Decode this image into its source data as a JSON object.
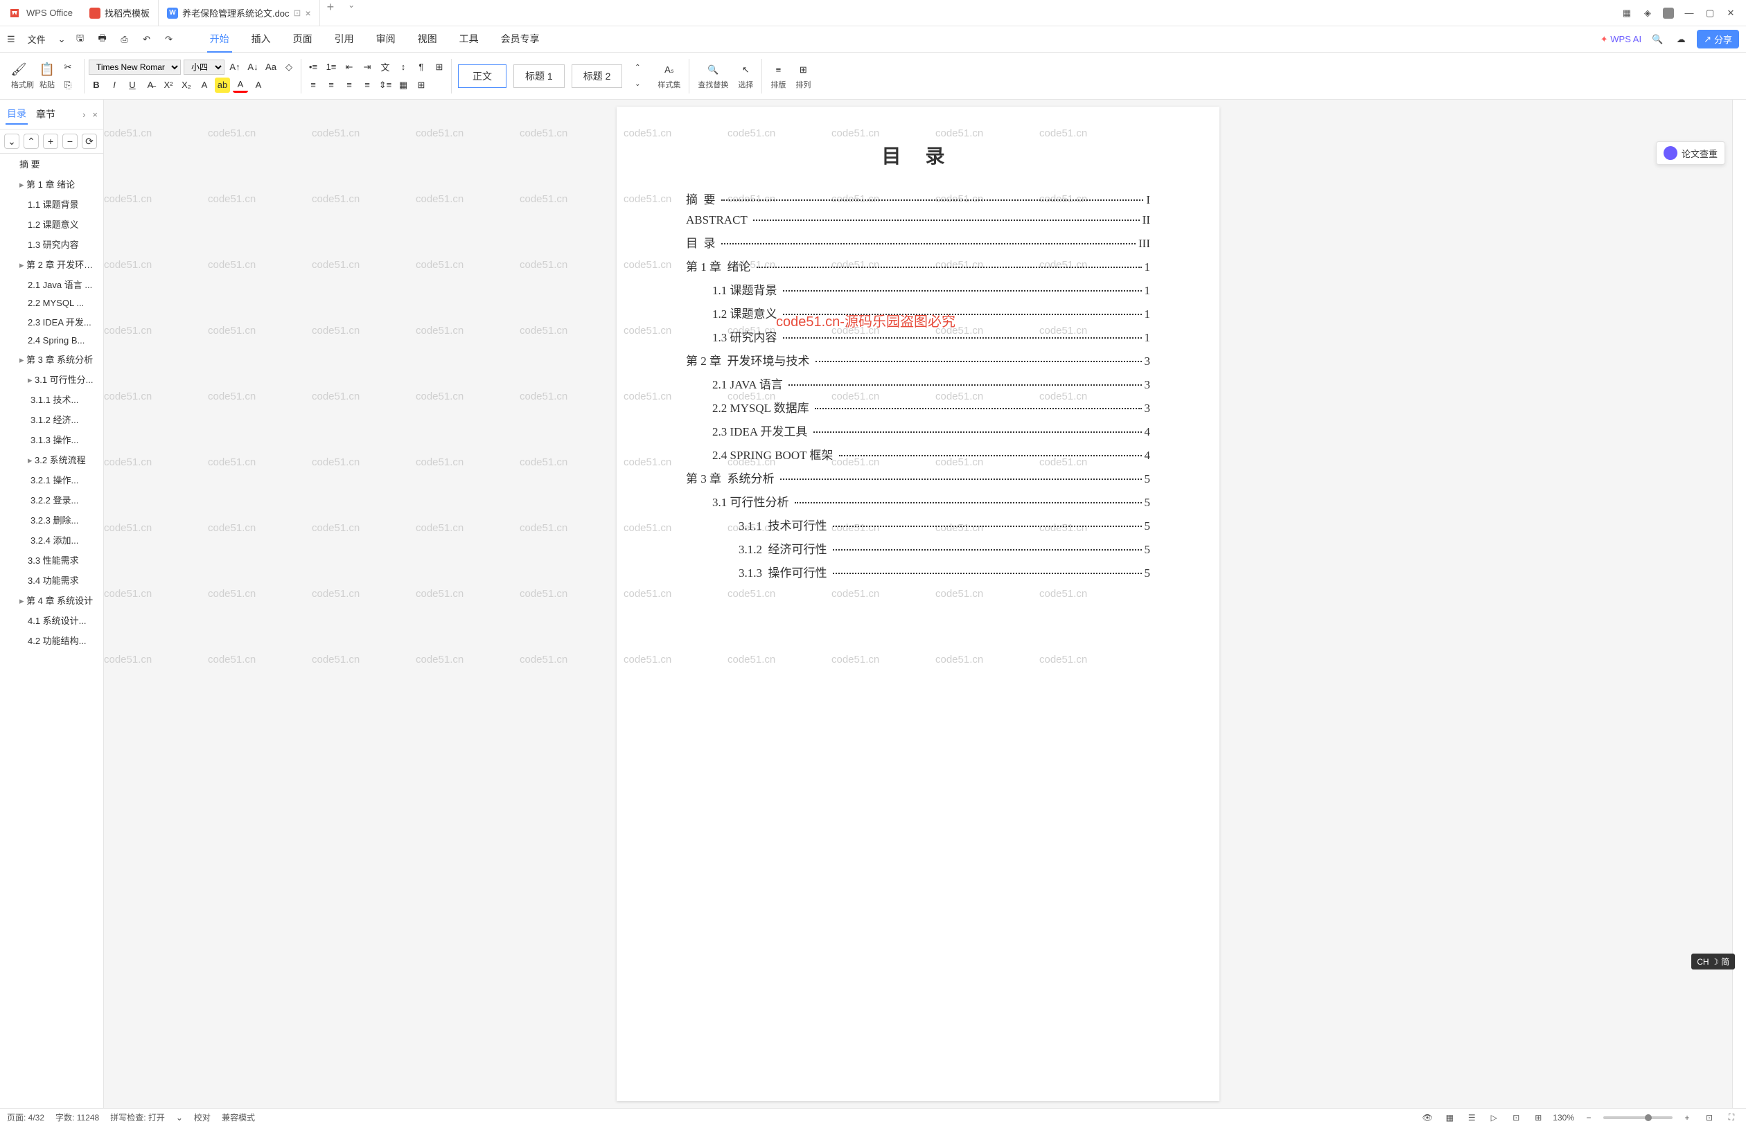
{
  "app": {
    "name": "WPS Office"
  },
  "tabs": [
    {
      "label": "找稻壳模板"
    },
    {
      "label": "养老保险管理系统论文.doc"
    }
  ],
  "menu": {
    "file": "文件",
    "items": [
      "开始",
      "插入",
      "页面",
      "引用",
      "审阅",
      "视图",
      "工具",
      "会员专享"
    ],
    "ai": "WPS AI",
    "share": "分享"
  },
  "toolbar": {
    "format_painter": "格式刷",
    "paste": "粘贴",
    "font": "Times New Romar",
    "size": "小四",
    "styles": [
      "正文",
      "标题 1",
      "标题 2"
    ],
    "styleset": "样式集",
    "findreplace": "查找替换",
    "select": "选择",
    "arrange_v": "排版",
    "arrange_h": "排列"
  },
  "sidebar": {
    "tabs": [
      "目录",
      "章节"
    ],
    "close": "×",
    "controls": [
      "⌄",
      "⌃",
      "+",
      "−",
      "⟳"
    ],
    "outline": [
      {
        "label": "摘 要",
        "level": 1
      },
      {
        "label": "第 1 章 绪论",
        "level": 1,
        "caret": true
      },
      {
        "label": "1.1 课题背景",
        "level": 2
      },
      {
        "label": "1.2 课题意义",
        "level": 2
      },
      {
        "label": "1.3 研究内容",
        "level": 2
      },
      {
        "label": "第 2 章 开发环境...",
        "level": 1,
        "caret": true
      },
      {
        "label": "2.1 Java 语言 ...",
        "level": 2
      },
      {
        "label": "2.2 MYSQL ...",
        "level": 2
      },
      {
        "label": "2.3 IDEA 开发...",
        "level": 2
      },
      {
        "label": "2.4 Spring B...",
        "level": 2
      },
      {
        "label": "第 3 章 系统分析",
        "level": 1,
        "caret": true
      },
      {
        "label": "3.1 可行性分...",
        "level": 2,
        "caret": true
      },
      {
        "label": "3.1.1 技术...",
        "level": 3
      },
      {
        "label": "3.1.2 经济...",
        "level": 3
      },
      {
        "label": "3.1.3 操作...",
        "level": 3
      },
      {
        "label": "3.2 系统流程",
        "level": 2,
        "caret": true
      },
      {
        "label": "3.2.1 操作...",
        "level": 3
      },
      {
        "label": "3.2.2 登录...",
        "level": 3
      },
      {
        "label": "3.2.3 删除...",
        "level": 3
      },
      {
        "label": "3.2.4 添加...",
        "level": 3
      },
      {
        "label": "3.3 性能需求",
        "level": 2
      },
      {
        "label": "3.4 功能需求",
        "level": 2
      },
      {
        "label": "第 4 章 系统设计",
        "level": 1,
        "caret": true
      },
      {
        "label": "4.1 系统设计...",
        "level": 2
      },
      {
        "label": "4.2 功能结构...",
        "level": 2
      }
    ]
  },
  "doc": {
    "title": "目 录",
    "toc": [
      {
        "text": "摘  要",
        "page": "I",
        "level": 1
      },
      {
        "text": "ABSTRACT",
        "page": "II",
        "level": 1
      },
      {
        "text": "目  录",
        "page": "III",
        "level": 1
      },
      {
        "text": "第 1 章  绪论",
        "page": "1",
        "level": 1
      },
      {
        "text": "1.1 课题背景",
        "page": "1",
        "level": 2
      },
      {
        "text": "1.2 课题意义",
        "page": "1",
        "level": 2
      },
      {
        "text": "1.3 研究内容",
        "page": "1",
        "level": 2
      },
      {
        "text": "第 2 章  开发环境与技术",
        "page": "3",
        "level": 1
      },
      {
        "text": "2.1 JAVA 语言",
        "page": "3",
        "level": 2
      },
      {
        "text": "2.2 MYSQL 数据库",
        "page": "3",
        "level": 2
      },
      {
        "text": "2.3 IDEA 开发工具",
        "page": "4",
        "level": 2
      },
      {
        "text": "2.4 SPRING BOOT 框架",
        "page": "4",
        "level": 2
      },
      {
        "text": "第 3 章  系统分析",
        "page": "5",
        "level": 1
      },
      {
        "text": "3.1 可行性分析",
        "page": "5",
        "level": 2
      },
      {
        "text": "3.1.1  技术可行性",
        "page": "5",
        "level": 3
      },
      {
        "text": "3.1.2  经济可行性",
        "page": "5",
        "level": 3
      },
      {
        "text": "3.1.3  操作可行性",
        "page": "5",
        "level": 3
      }
    ],
    "watermark_text": "code51.cn",
    "watermark_red": "code51.cn-源码乐园盗图必究",
    "paper_check": "论文查重"
  },
  "status": {
    "page": "页面: 4/32",
    "words": "字数: 11248",
    "spell": "拼写检查: 打开",
    "proof": "校对",
    "compat": "兼容模式",
    "zoom": "130%",
    "ime": "CH ☽ 简"
  }
}
